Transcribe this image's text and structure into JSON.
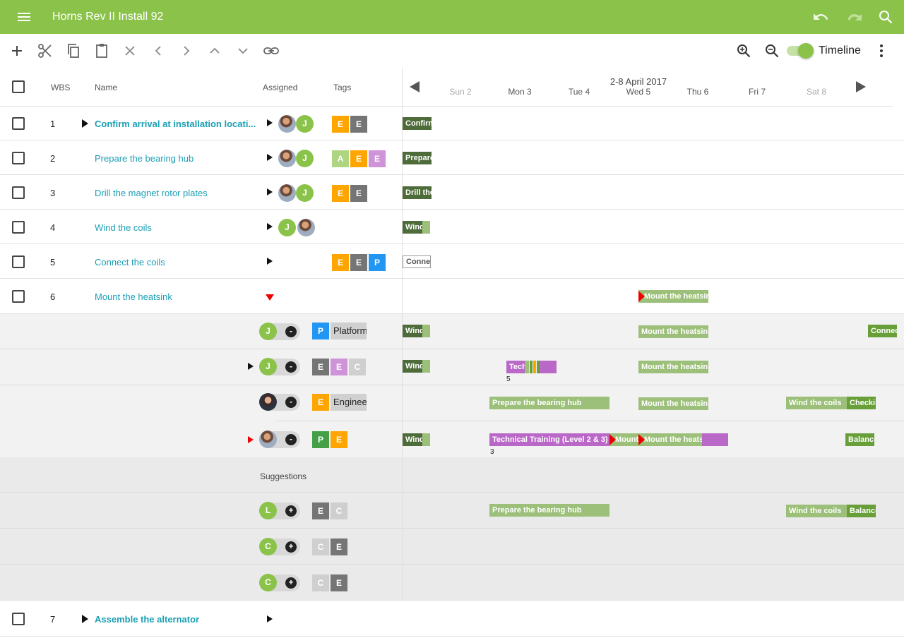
{
  "app": {
    "title": "Horns Rev II Install 92"
  },
  "toolbar": {
    "timeline_label": "Timeline"
  },
  "columns": {
    "wbs": "WBS",
    "name": "Name",
    "assigned": "Assigned",
    "tags": "Tags"
  },
  "timeline": {
    "range_label": "2-8 April 2017",
    "days": [
      "Sun 2",
      "Mon 3",
      "Tue 4",
      "Wed 5",
      "Thu 6",
      "Fri 7",
      "Sat 8"
    ]
  },
  "tasks": [
    {
      "wbs": "1",
      "name": "Confirm arrival at installation locati...",
      "bar": "Confirm"
    },
    {
      "wbs": "2",
      "name": "Prepare the bearing hub",
      "bar": "Prepare"
    },
    {
      "wbs": "3",
      "name": "Drill the magnet rotor plates",
      "bar": "Drill the"
    },
    {
      "wbs": "4",
      "name": "Wind the coils",
      "bar": "Wind th"
    },
    {
      "wbs": "5",
      "name": "Connect the coils",
      "bar": "Connec"
    },
    {
      "wbs": "6",
      "name": "Mount the heatsink",
      "bar": "Mount the heatsink"
    },
    {
      "wbs": "7",
      "name": "Assemble the alternator"
    }
  ],
  "tags_text": {
    "platform": "Platform",
    "engineer": "Enginee"
  },
  "resources": [
    {
      "initial": "J",
      "bars": [
        "Windth",
        "Mount the heatsink",
        "Connec"
      ]
    },
    {
      "initial": "J",
      "bars": [
        "Windth",
        "Tech",
        "Mount the heatsink"
      ],
      "count": "5"
    },
    {
      "bars": [
        "Prepare the bearing hub",
        "Mount the heatsink",
        "Wind the coils",
        "Checkin"
      ]
    },
    {
      "bars": [
        "Windth",
        "Technical Training (Level 2 & 3)",
        "Mount t",
        "Mount the heatsin",
        "Balance"
      ],
      "count": "3"
    }
  ],
  "suggestions": {
    "label": "Suggestions",
    "items": [
      {
        "initial": "L",
        "bars": [
          "Prepare the bearing hub",
          "Wind the coils",
          "Balance"
        ]
      },
      {
        "initial": "C"
      },
      {
        "initial": "C"
      }
    ]
  },
  "tag_letters": {
    "E": "E",
    "A": "A",
    "P": "P",
    "C": "C"
  },
  "colors": {
    "appbar": "#8bc34a",
    "link": "#1a9fb5",
    "bar_dark": "#4e6b3a",
    "bar_light": "#9cc07a",
    "bar_purple": "#ba68c8",
    "tag_orange": "#ffa500",
    "tag_blue": "#2196f3"
  }
}
